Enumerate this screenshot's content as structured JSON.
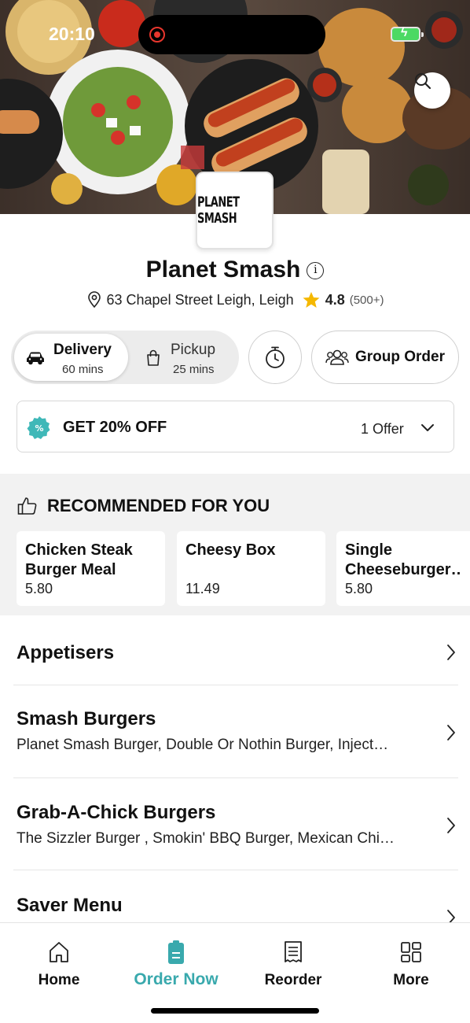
{
  "status_bar": {
    "time": "20:10"
  },
  "restaurant": {
    "logo_text": "PLANET SMASH",
    "name": "Planet Smash",
    "address": "63 Chapel Street Leigh, Leigh",
    "rating": "4.8",
    "rating_count": "(500+)"
  },
  "order_modes": {
    "delivery": {
      "label": "Delivery",
      "time": "60 mins"
    },
    "pickup": {
      "label": "Pickup",
      "time": "25 mins"
    },
    "group_order_label": "Group Order"
  },
  "offer": {
    "title": "GET 20% OFF",
    "count": "1 Offer"
  },
  "recommended": {
    "heading": "RECOMMENDED FOR YOU",
    "items": [
      {
        "name": "Chicken Steak Burger Meal",
        "price": "5.80"
      },
      {
        "name": "Cheesy Box",
        "price": "11.49"
      },
      {
        "name": "Single Cheeseburger…",
        "price": "5.80"
      }
    ]
  },
  "categories": [
    {
      "name": "Appetisers",
      "description": ""
    },
    {
      "name": "Smash Burgers",
      "description": "Planet Smash Burger, Double Or Nothin Burger, Inject…"
    },
    {
      "name": "Grab-A-Chick Burgers",
      "description": "The Sizzler Burger , Smokin' BBQ Burger, Mexican Chi…"
    },
    {
      "name": "Saver Menu",
      "description": ""
    }
  ],
  "tab_bar": {
    "items": [
      {
        "label": "Home",
        "icon": "home-icon"
      },
      {
        "label": "Order Now",
        "icon": "order-icon"
      },
      {
        "label": "Reorder",
        "icon": "receipt-icon"
      },
      {
        "label": "More",
        "icon": "grid-icon"
      }
    ]
  },
  "colors": {
    "accent": "#39a9ad",
    "star": "#f5b800",
    "battery": "#4cd964",
    "recording": "#e8362d"
  }
}
